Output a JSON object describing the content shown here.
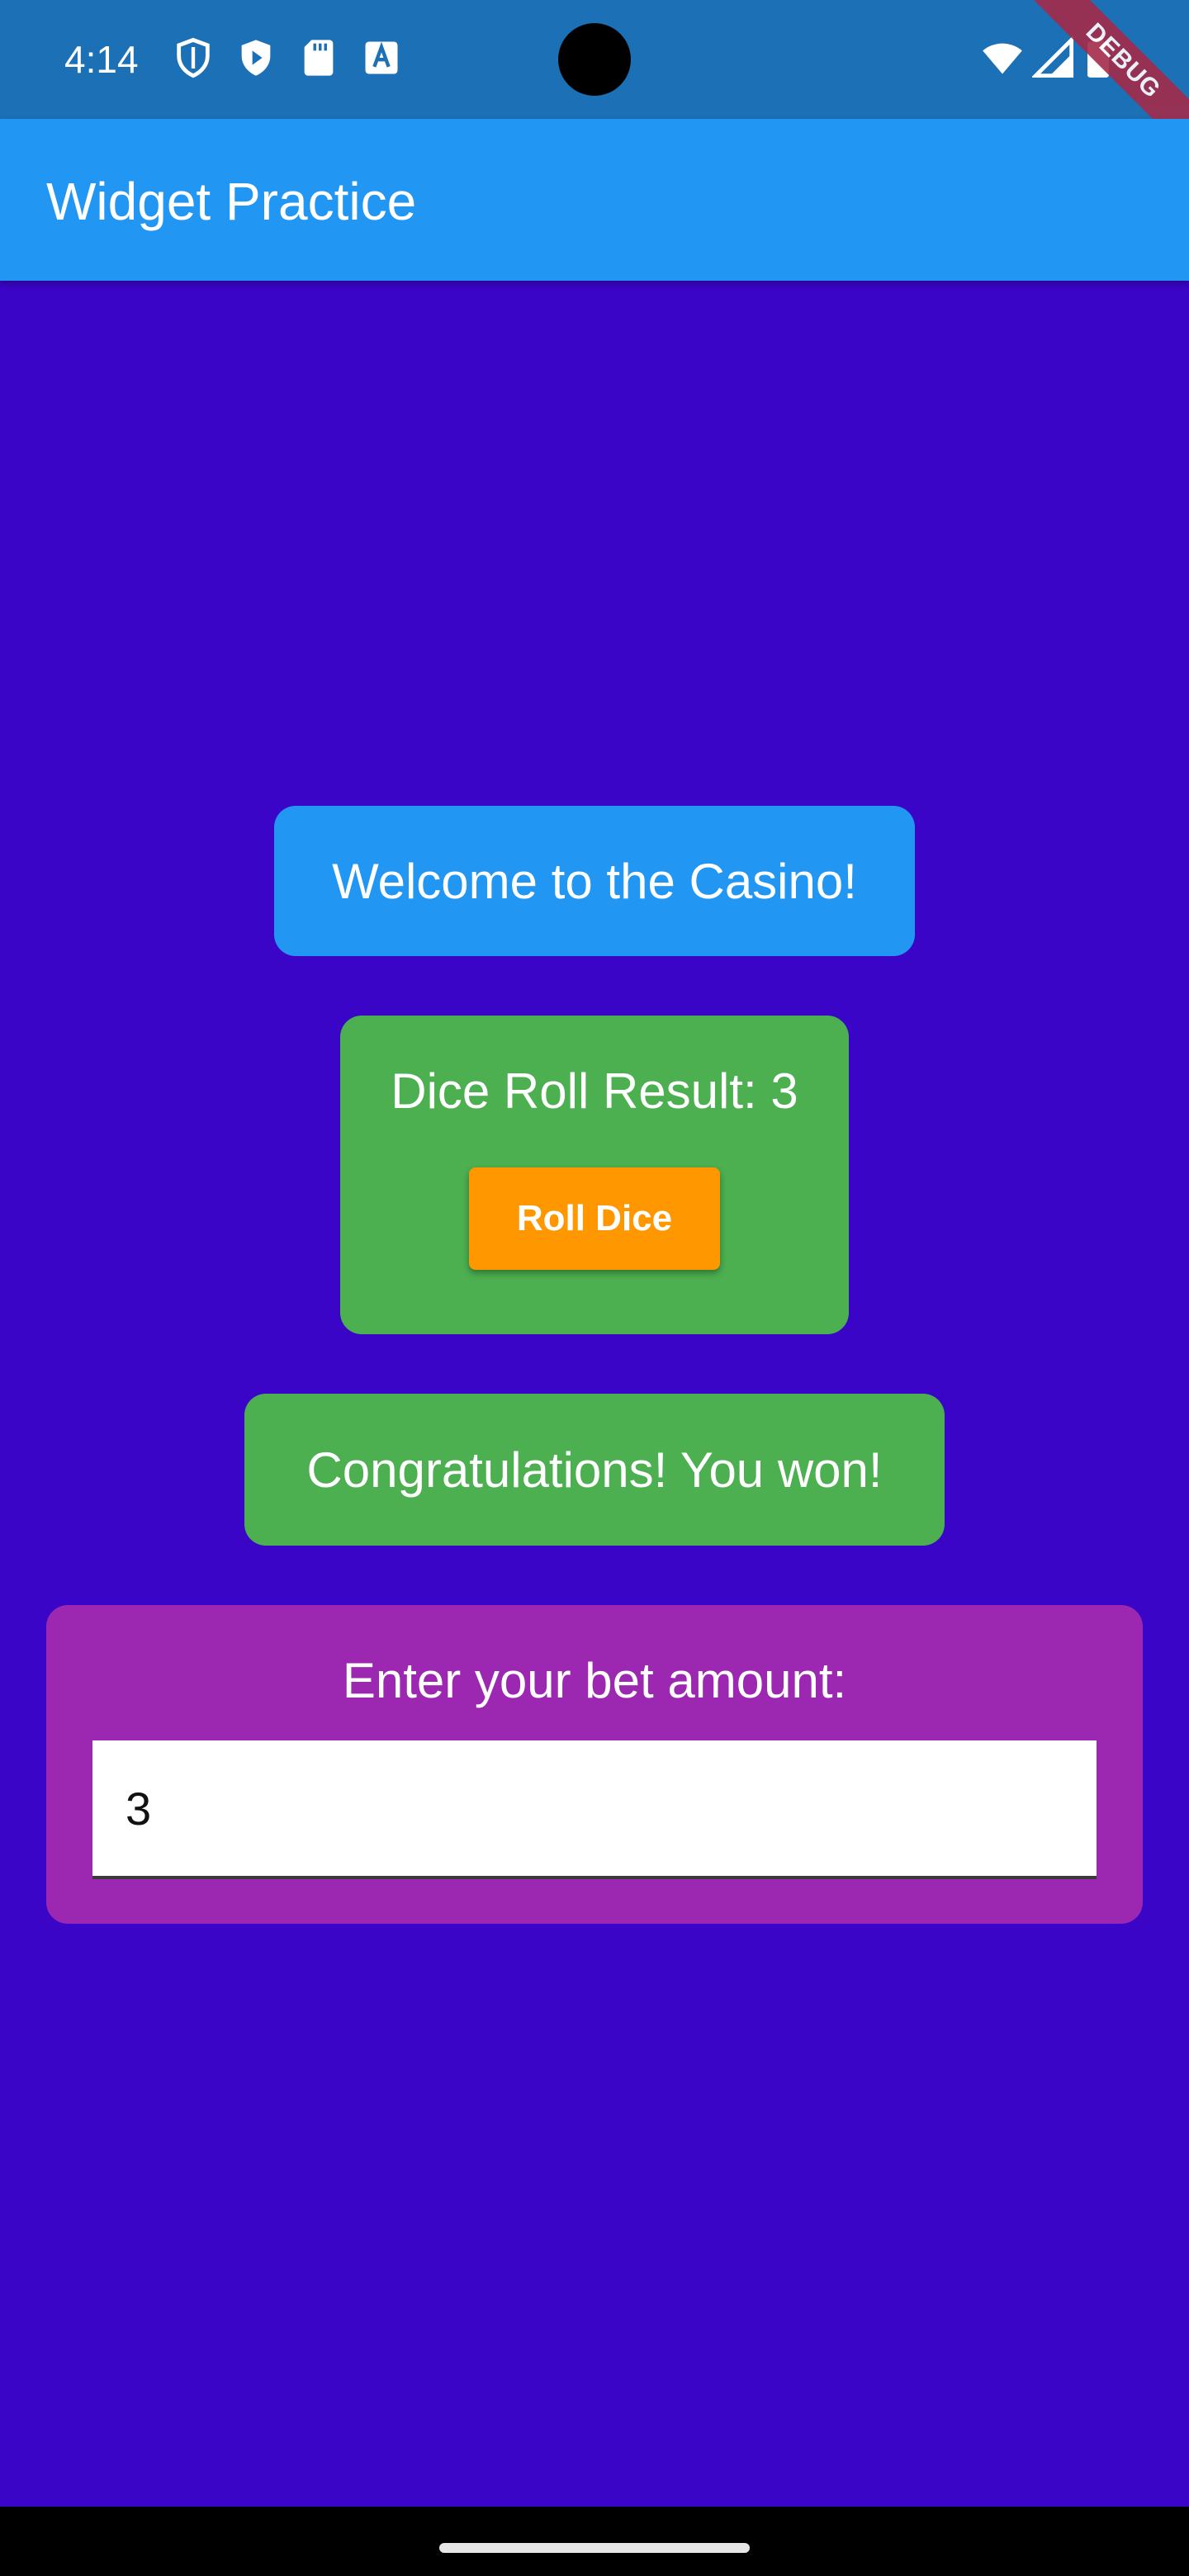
{
  "status_bar": {
    "time": "4:14",
    "icons": [
      "shield-icon",
      "play-protect-icon",
      "sd-card-icon",
      "a-text-icon",
      "wifi-icon",
      "signal-icon",
      "battery-icon"
    ],
    "debug_banner": "DEBUG"
  },
  "app_bar": {
    "title": "Widget Practice",
    "color": "#2196f3"
  },
  "main": {
    "background": "#3a05c7",
    "welcome_text": "Welcome to the Casino!",
    "dice_result_text": "Dice Roll Result: 3",
    "roll_button_label": "Roll Dice",
    "result_message": "Congratulations! You won!",
    "bet_label": "Enter your bet amount:",
    "bet_value": "3"
  },
  "colors": {
    "welcome_card": "#2196f3",
    "dice_card": "#4caf50",
    "roll_button": "#ff9800",
    "result_card": "#4caf50",
    "bet_card": "#9c27b0"
  }
}
